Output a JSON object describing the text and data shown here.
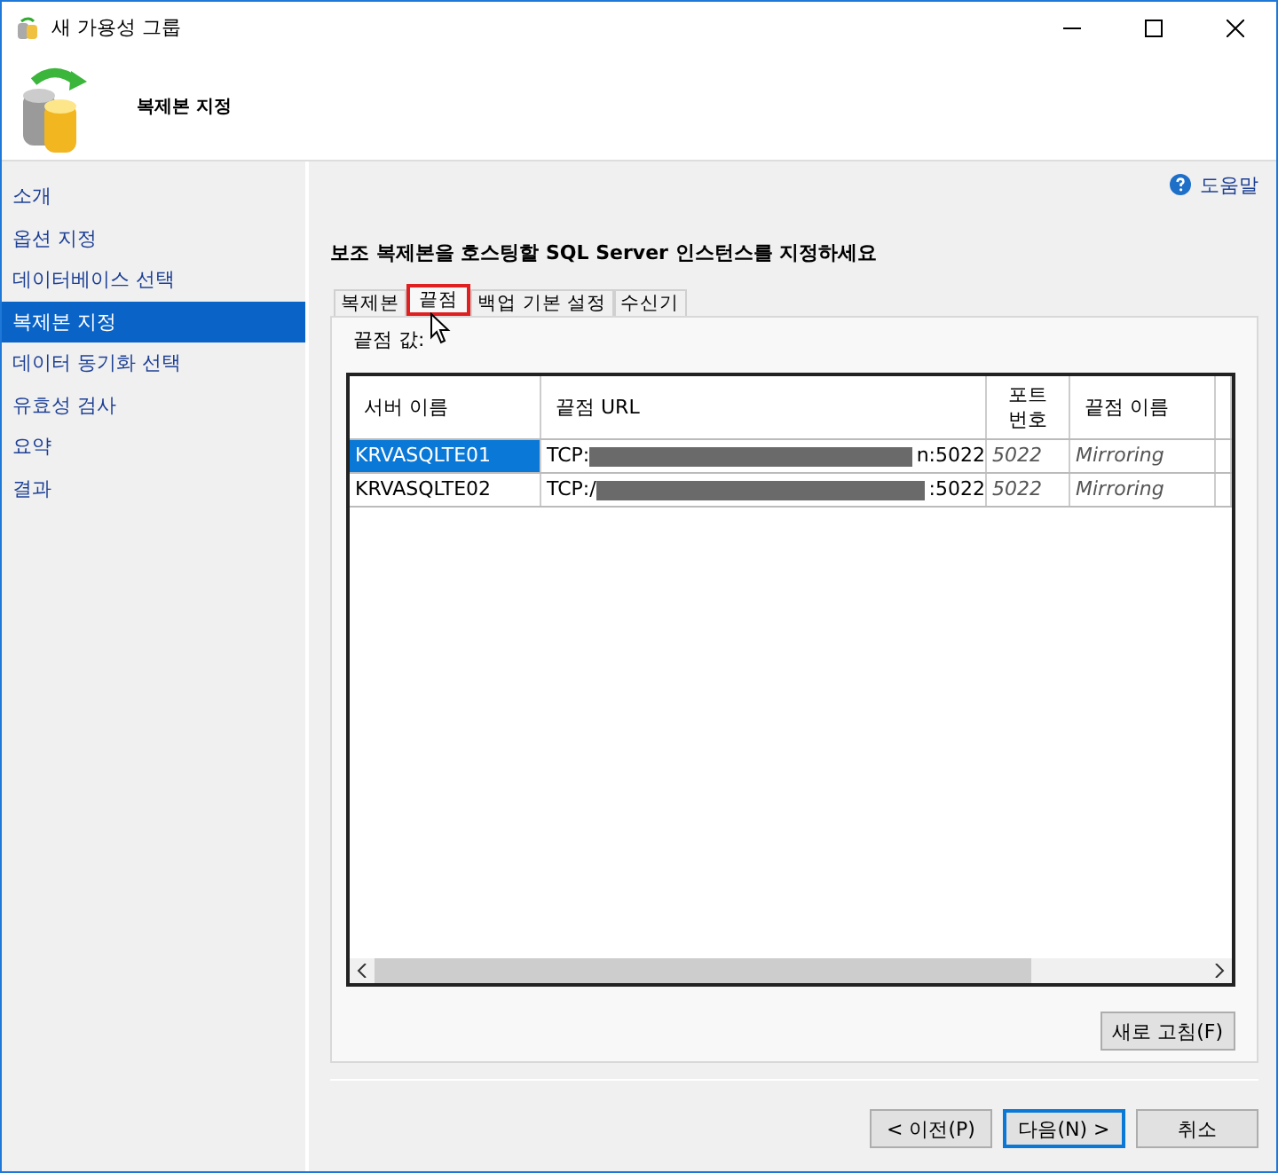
{
  "window": {
    "title": "새 가용성 그룹"
  },
  "header": {
    "title": "복제본 지정"
  },
  "sidebar": {
    "items": [
      {
        "label": "소개",
        "selected": false
      },
      {
        "label": "옵션 지정",
        "selected": false
      },
      {
        "label": "데이터베이스 선택",
        "selected": false
      },
      {
        "label": "복제본 지정",
        "selected": true
      },
      {
        "label": "데이터 동기화 선택",
        "selected": false
      },
      {
        "label": "유효성 검사",
        "selected": false
      },
      {
        "label": "요약",
        "selected": false
      },
      {
        "label": "결과",
        "selected": false
      }
    ]
  },
  "help_link": "도움말",
  "heading": "보조 복제본을 호스팅할 SQL Server 인스턴스를 지정하세요",
  "tabs": [
    {
      "label": "복제본",
      "selected": false,
      "highlighted": false
    },
    {
      "label": "끝점",
      "selected": true,
      "highlighted": true
    },
    {
      "label": "백업 기본 설정",
      "selected": false,
      "highlighted": false
    },
    {
      "label": "수신기",
      "selected": false,
      "highlighted": false
    }
  ],
  "endpoint_label": "끝점 값:",
  "table": {
    "columns": [
      "서버 이름",
      "끝점 URL",
      "포트\n번호",
      "끝점 이름"
    ],
    "rows": [
      {
        "server": "KRVASQLTE01",
        "url_prefix": "TCP:",
        "url_suffix": "n:5022",
        "port": "5022",
        "endpoint_name": "Mirroring",
        "selected": true
      },
      {
        "server": "KRVASQLTE02",
        "url_prefix": "TCP:/",
        "url_suffix": ":5022",
        "port": "5022",
        "endpoint_name": "Mirroring",
        "selected": false
      }
    ]
  },
  "refresh_button": "새로 고침(F)",
  "buttons": [
    {
      "label": "< 이전(P)",
      "default": false
    },
    {
      "label": "다음(N) >",
      "default": true
    },
    {
      "label": "취소",
      "default": false
    }
  ]
}
